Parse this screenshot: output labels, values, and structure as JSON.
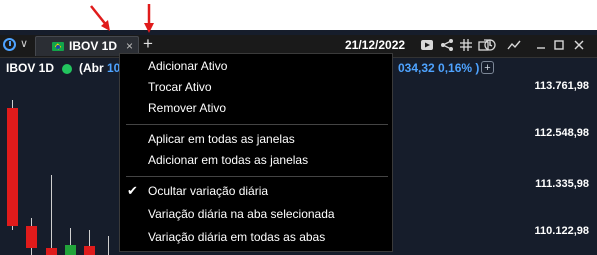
{
  "toolbar": {
    "tab_label": "IBOV 1D",
    "tab_close": "×",
    "add_tab": "+",
    "date": "21/12/2022",
    "chevron": "∨"
  },
  "chart": {
    "symbol": "IBOV 1D",
    "open_prefix": "(Abr ",
    "open_value": "10",
    "variation": "034,32 0,16% )",
    "add_indicator": "+",
    "price_levels": [
      "113.761,98",
      "112.548,98",
      "111.335,98",
      "110.122,98"
    ]
  },
  "menu": {
    "items": [
      {
        "label": "Adicionar Ativo"
      },
      {
        "label": "Trocar Ativo"
      },
      {
        "label": "Remover Ativo"
      },
      {
        "label": "Aplicar em todas as janelas"
      },
      {
        "label": "Adicionar em todas as janelas"
      },
      {
        "label": "Ocultar variação diária",
        "checked": true
      },
      {
        "label": "Variação diária na aba selecionada"
      },
      {
        "label": "Variação diária em todas as abas"
      }
    ],
    "check_mark": "✔"
  },
  "colors": {
    "accent": "#4ea3ff",
    "annotation_arrow": "#e01b1b",
    "candle_up": "#22a43a",
    "candle_down": "#e01b1b"
  }
}
